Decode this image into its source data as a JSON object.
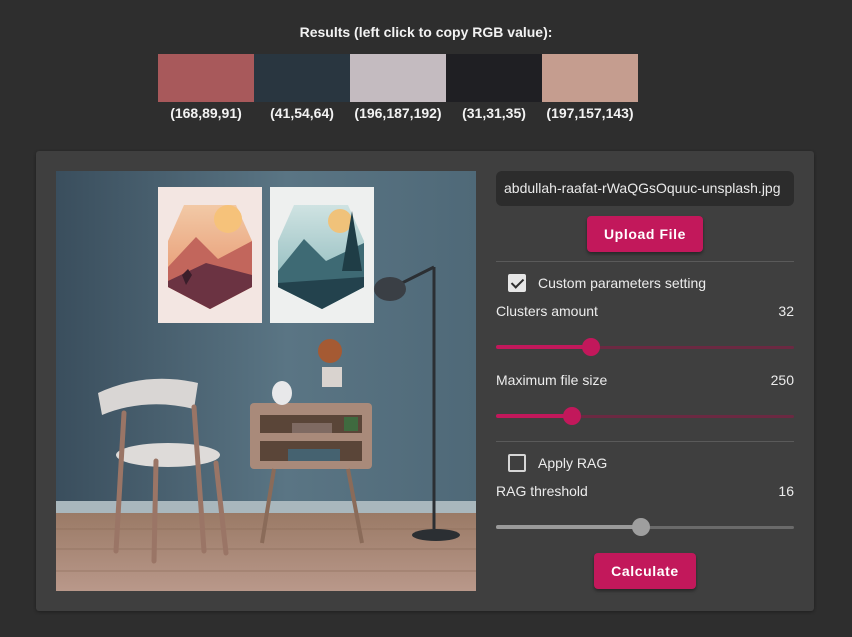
{
  "results": {
    "title": "Results (left click to copy RGB value):",
    "swatches": [
      {
        "color": "#a8595b",
        "label": "(168,89,91)"
      },
      {
        "color": "#293640",
        "label": "(41,54,64)"
      },
      {
        "color": "#c4bbc0",
        "label": "(196,187,192)"
      },
      {
        "color": "#1f1f23",
        "label": "(31,31,35)"
      },
      {
        "color": "#c59d8f",
        "label": "(197,157,143)"
      }
    ]
  },
  "preview": {
    "image_description": "photo-preview"
  },
  "controls": {
    "filename": "abdullah-raafat-rWaQGsOquuc-unsplash.jpg",
    "upload_label": "Upload File",
    "custom_params": {
      "label": "Custom parameters setting",
      "checked": true
    },
    "clusters": {
      "label": "Clusters amount",
      "value": "32",
      "fraction": 0.32
    },
    "max_file_size": {
      "label": "Maximum file size",
      "value": "250",
      "fraction": 0.255
    },
    "apply_rag": {
      "label": "Apply RAG",
      "checked": false
    },
    "rag_threshold": {
      "label": "RAG threshold",
      "value": "16",
      "fraction": 0.485
    },
    "calculate_label": "Calculate"
  },
  "colors": {
    "accent": "#c2185b",
    "background": "#2e2e2e",
    "panel": "#3f3f3f"
  }
}
